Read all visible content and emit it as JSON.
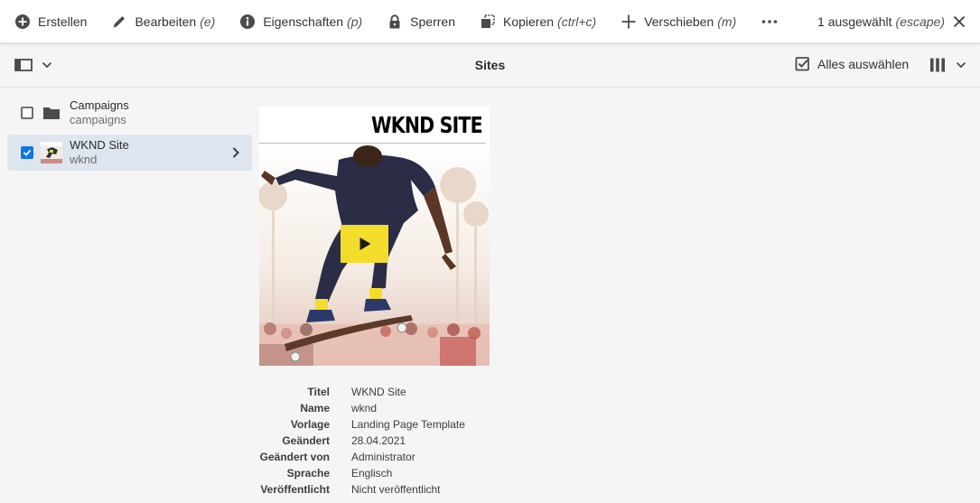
{
  "actionbar": {
    "actions": [
      {
        "label": "Erstellen",
        "shortcut": "",
        "icon": "add-circle-icon"
      },
      {
        "label": "Bearbeiten",
        "shortcut": "(e)",
        "icon": "edit-icon"
      },
      {
        "label": "Eigenschaften",
        "shortcut": "(p)",
        "icon": "info-icon"
      },
      {
        "label": "Sperren",
        "shortcut": "",
        "icon": "lock-icon"
      },
      {
        "label": "Kopieren",
        "shortcut": "(ctrl+c)",
        "icon": "copy-icon"
      },
      {
        "label": "Verschieben",
        "shortcut": "(m)",
        "icon": "move-icon"
      }
    ],
    "more_icon": "more-icon",
    "selection_status": "1 ausgewählt",
    "selection_shortcut": "(escape)",
    "close_icon": "close-icon"
  },
  "subheader": {
    "rail_icon": "rail-toggle-icon",
    "title": "Sites",
    "select_all": "Alles auswählen",
    "view_icon": "column-view-icon"
  },
  "column": {
    "items": [
      {
        "title": "Campaigns",
        "name": "campaigns",
        "selected": false,
        "icon": "folder-icon"
      },
      {
        "title": "WKND Site",
        "name": "wknd",
        "selected": true,
        "icon": "site-thumbnail-icon"
      }
    ]
  },
  "preview": {
    "brand": "WKND SITE",
    "video_icon": "play-icon"
  },
  "meta": [
    {
      "label": "Titel",
      "value": "WKND Site"
    },
    {
      "label": "Name",
      "value": "wknd"
    },
    {
      "label": "Vorlage",
      "value": "Landing Page Template"
    },
    {
      "label": "Geändert",
      "value": "28.04.2021"
    },
    {
      "label": "Geändert von",
      "value": "Administrator"
    },
    {
      "label": "Sprache",
      "value": "Englisch"
    },
    {
      "label": "Veröffentlicht",
      "value": "Nicht veröffentlicht"
    }
  ],
  "colors": {
    "accent": "#1473e6",
    "selected_row": "#dde6ef",
    "play_button": "#f4dc2a"
  }
}
